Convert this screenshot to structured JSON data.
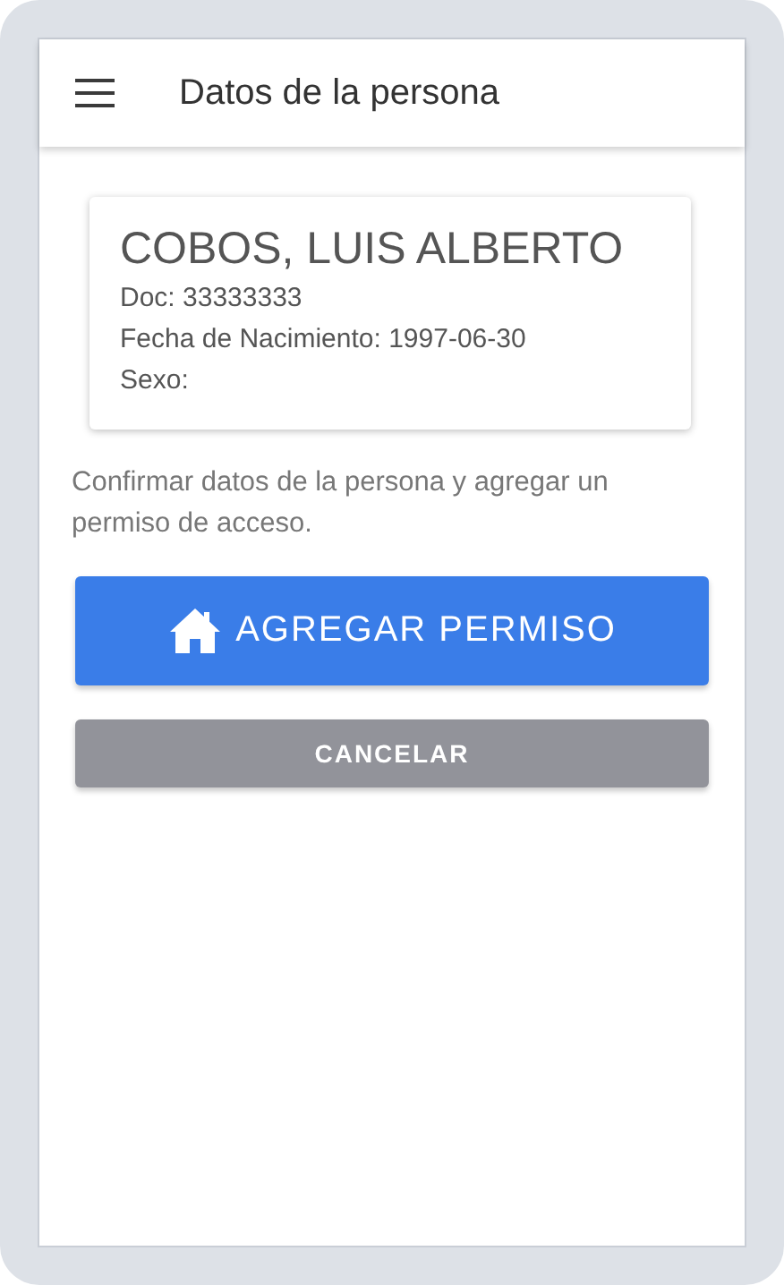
{
  "app_bar": {
    "title": "Datos de la persona"
  },
  "person": {
    "name": "COBOS, LUIS ALBERTO",
    "details": [
      "Doc: 33333333",
      "Fecha de Nacimiento: 1997-06-30",
      "Sexo:"
    ]
  },
  "instructions": "Confirmar datos de la persona y agregar un permiso de acceso.",
  "buttons": [
    {
      "kind": "primary",
      "label": "AGREGAR PERMISO"
    },
    {
      "kind": "secondary",
      "label": "CANCELAR"
    }
  ]
}
